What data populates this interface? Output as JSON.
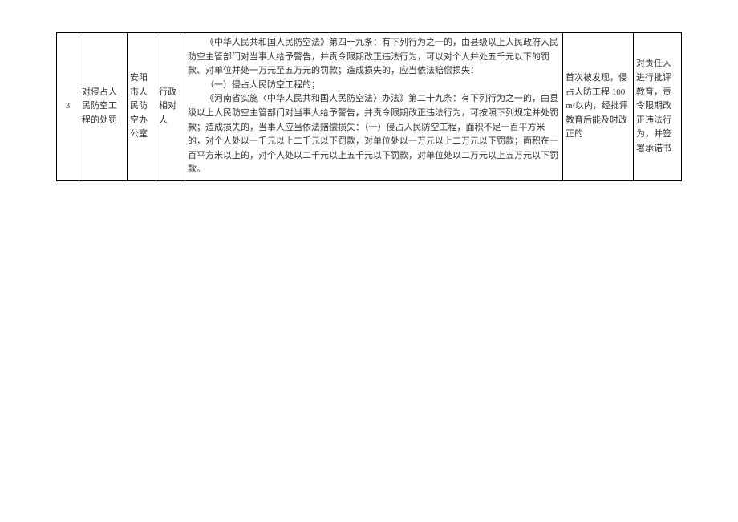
{
  "row": {
    "num": "3",
    "matter": "对侵占人民防空工程的处罚",
    "dept": "安阳市人民防空办公室",
    "type": "行政相对人",
    "basis_p1": "《中华人民共和国人民防空法》第四十九条：有下列行为之一的，由县级以上人民政府人民防空主管部门对当事人给予警告，并责令限期改正违法行为，可以对个人并处五千元以下的罚款、对单位并处一万元至五万元的罚款；造成损失的，应当依法赔偿损失：",
    "basis_p2": "（一）侵占人民防空工程的；",
    "basis_p3": "《河南省实施〈中华人民共和国人民防空法〉办法》第二十九条：有下列行为之一的，由县级以上人民防空主管部门对当事人给予警告，并责令限期改正违法行为，可按照下列规定并处罚款；造成损失的，当事人应当依法赔偿损失：（一）侵占人民防空工程，面积不足一百平方米的，对个人处以一千元以上二千元以下罚款，对单位处以一万元以上二万元以下罚款；面积在一百平方米以上的，对个人处以二千元以上五千元以下罚款，对单位处以二万元以上五万元以下罚款。",
    "condition": "首次被发现，侵占人防工程 100m²以内，经批评教育后能及时改正的",
    "result": "对责任人进行批评教育，责令限期改正违法行为，并签署承诺书"
  }
}
